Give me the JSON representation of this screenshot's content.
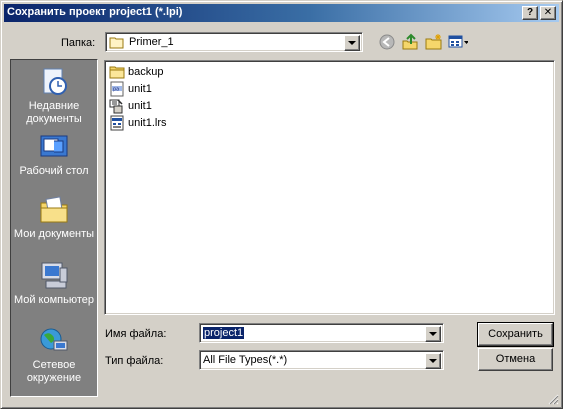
{
  "window": {
    "title": "Сохранить проект project1 (*.lpi)",
    "help_label": "?",
    "close_label": "✕"
  },
  "location": {
    "label": "Папка:",
    "value": "Primer_1"
  },
  "toolbar": {
    "icons": [
      "back-icon",
      "up-folder-icon",
      "new-folder-icon",
      "view-menu-icon"
    ]
  },
  "places": [
    {
      "label": "Недавние документы",
      "icon": "recent-documents-icon"
    },
    {
      "label": "Рабочий стол",
      "icon": "desktop-icon"
    },
    {
      "label": "Мои документы",
      "icon": "my-documents-icon"
    },
    {
      "label": "Мой компьютер",
      "icon": "my-computer-icon"
    },
    {
      "label": "Сетевое окружение",
      "icon": "network-icon"
    }
  ],
  "files": [
    {
      "name": "backup",
      "icon": "folder-icon"
    },
    {
      "name": "unit1",
      "icon": "pascal-file-icon"
    },
    {
      "name": "unit1",
      "icon": "form-file-icon"
    },
    {
      "name": "unit1.lrs",
      "icon": "resource-file-icon"
    }
  ],
  "filename": {
    "label": "Имя файла:",
    "value": "project1"
  },
  "filetype": {
    "label": "Тип файла:",
    "value": "All File Types(*.*)"
  },
  "buttons": {
    "save": "Сохранить",
    "cancel": "Отмена"
  },
  "colors": {
    "title_bar": "#0a246a",
    "dialog_face": "#d4d0c8",
    "places_bar": "#808080",
    "selection": "#0a246a"
  }
}
